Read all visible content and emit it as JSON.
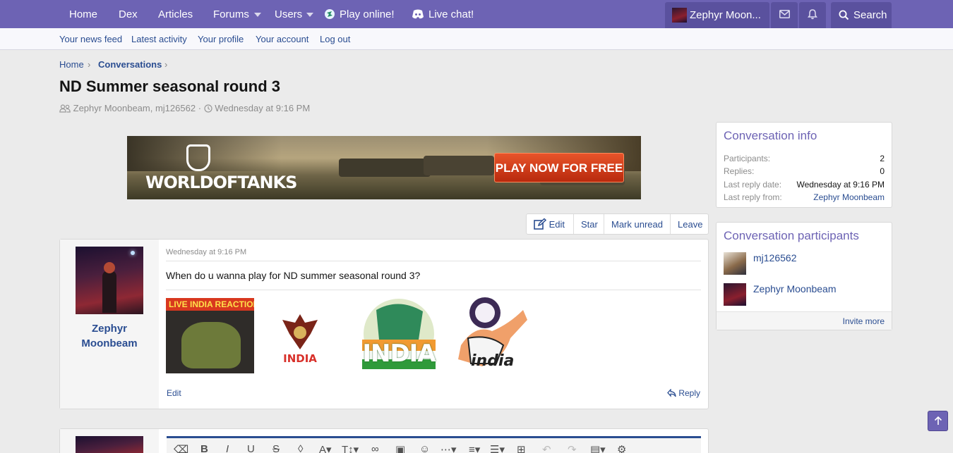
{
  "nav": {
    "home": "Home",
    "dex": "Dex",
    "articles": "Articles",
    "forums": "Forums",
    "users": "Users",
    "play_online": "Play online!",
    "live_chat": "Live chat!",
    "user": "Zephyr Moon...",
    "search": "Search"
  },
  "subnav": {
    "news_feed": "Your news feed",
    "latest_activity": "Latest activity",
    "profile": "Your profile",
    "account": "Your account",
    "logout": "Log out"
  },
  "breadcrumb": {
    "home": "Home",
    "current": "Conversations"
  },
  "page": {
    "title": "ND Summer seasonal round 3",
    "participants_line": "Zephyr Moonbeam, mj126562",
    "separator": "·",
    "date": "Wednesday at 9:16 PM"
  },
  "banner": {
    "brand": "WORLDOFTANKS",
    "cta": "PLAY NOW FOR FREE"
  },
  "actions": {
    "edit": "Edit",
    "star": "Star",
    "mark_unread": "Mark unread",
    "leave": "Leave"
  },
  "message": {
    "author_line1": "Zephyr",
    "author_line2": "Moonbeam",
    "date": "Wednesday at 9:16 PM",
    "text": "When do u wanna play for ND summer seasonal round 3?",
    "image1_header": "LIVE INDIA REACTION",
    "sticker2": "INDIA",
    "sticker3": "INDIA",
    "sticker4": "india",
    "edit": "Edit",
    "reply": "Reply"
  },
  "info": {
    "title": "Conversation info",
    "rows": [
      {
        "k": "Participants:",
        "v": "2"
      },
      {
        "k": "Replies:",
        "v": "0"
      },
      {
        "k": "Last reply date:",
        "v": "Wednesday at 9:16 PM"
      },
      {
        "k": "Last reply from:",
        "v": "Zephyr Moonbeam"
      }
    ]
  },
  "participants": {
    "title": "Conversation participants",
    "list": [
      "mj126562",
      "Zephyr Moonbeam"
    ],
    "invite": "Invite more"
  },
  "colors": {
    "nav": "#6d63b4",
    "link": "#2a4d91",
    "cta": "#d8401a"
  }
}
